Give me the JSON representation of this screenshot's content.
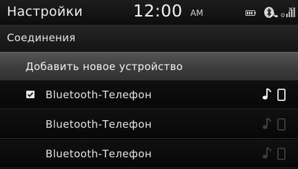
{
  "statusbar": {
    "title": "Настройки",
    "time": "12:00",
    "ampm": "AM",
    "icons": [
      "battery-icon",
      "bluetooth-phone-icon",
      "signal-icon"
    ]
  },
  "subheader": {
    "title": "Соединения"
  },
  "add_device": {
    "label": "Добавить новое устройство"
  },
  "devices": [
    {
      "name": "Bluetooth-Телефон",
      "connected": true,
      "audio_active": true,
      "phone_active": true
    },
    {
      "name": "Bluetooth-Телефон",
      "connected": false,
      "audio_active": false,
      "phone_active": false
    },
    {
      "name": "Bluetooth-Телефон",
      "connected": false,
      "audio_active": false,
      "phone_active": false
    }
  ],
  "colors": {
    "background": "#050505",
    "highlight_row": "#444444",
    "text": "#e8e8e8"
  }
}
